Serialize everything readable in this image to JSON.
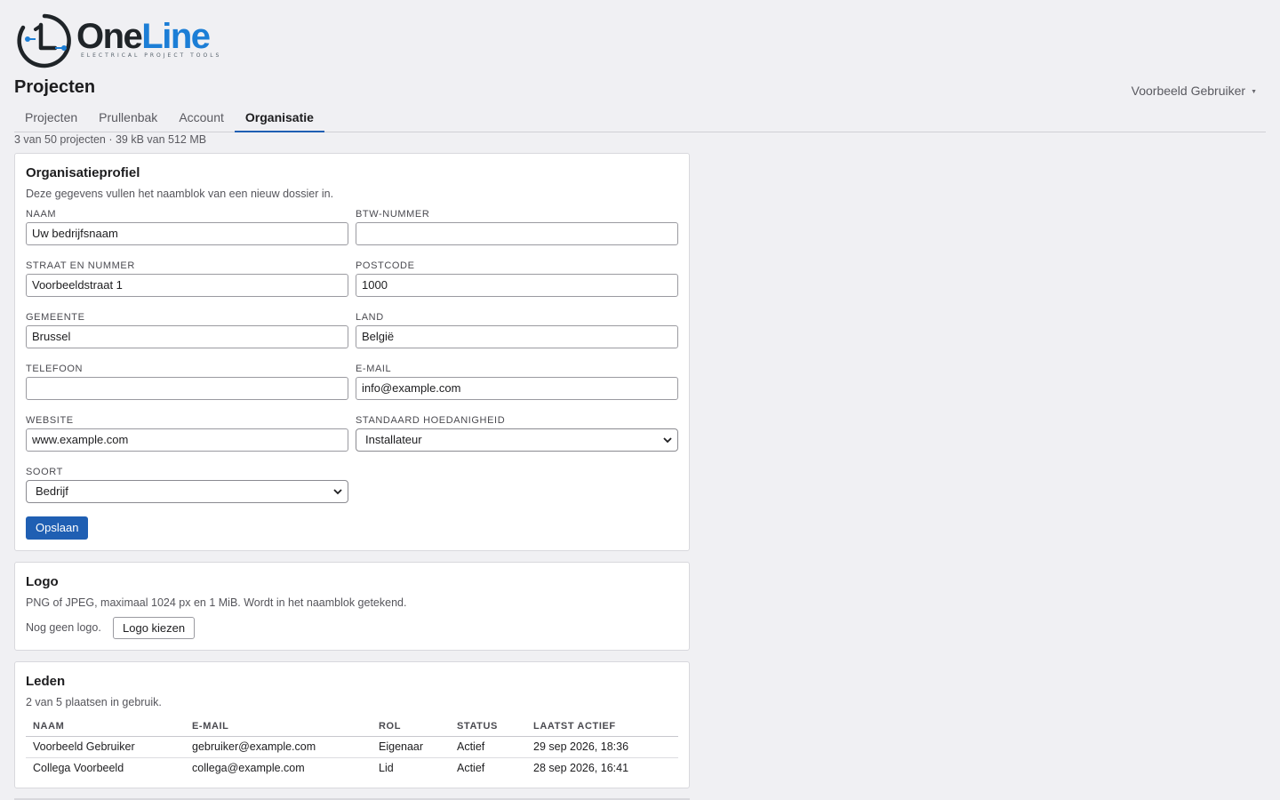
{
  "brand": {
    "name_part1": "One",
    "name_part2": "Line",
    "tagline": "ELECTRICAL PROJECT TOOLS",
    "color_dark": "#1f2428",
    "color_accent": "#1c7ed6"
  },
  "header": {
    "title": "Projecten",
    "user_name": "Voorbeeld Gebruiker",
    "user_menu_icon": "caret-down-icon"
  },
  "tabs": [
    {
      "label": "Projecten",
      "active": false
    },
    {
      "label": "Prullenbak",
      "active": false
    },
    {
      "label": "Account",
      "active": false
    },
    {
      "label": "Organisatie",
      "active": true
    }
  ],
  "usage": "3 van 50 projecten · 39 kB van 512 MB",
  "org_profile": {
    "title": "Organisatieprofiel",
    "description": "Deze gegevens vullen het naamblok van een nieuw dossier in.",
    "fields": {
      "naam": {
        "label": "NAAM",
        "value": "Uw bedrijfsnaam"
      },
      "btw": {
        "label": "BTW-NUMMER",
        "value": ""
      },
      "straat": {
        "label": "STRAAT EN NUMMER",
        "value": "Voorbeeldstraat 1"
      },
      "postcode": {
        "label": "POSTCODE",
        "value": "1000"
      },
      "gemeente": {
        "label": "GEMEENTE",
        "value": "Brussel"
      },
      "land": {
        "label": "LAND",
        "value": "België"
      },
      "telefoon": {
        "label": "TELEFOON",
        "value": ""
      },
      "email": {
        "label": "E-MAIL",
        "value": "info@example.com"
      },
      "website": {
        "label": "WEBSITE",
        "value": "www.example.com"
      },
      "hoedanigheid": {
        "label": "STANDAARD HOEDANIGHEID",
        "value": "Installateur"
      },
      "soort": {
        "label": "SOORT",
        "value": "Bedrijf"
      }
    },
    "save_label": "Opslaan",
    "accent_color": "#1f5fb3"
  },
  "logo_section": {
    "title": "Logo",
    "description": "PNG of JPEG, maximaal 1024 px en 1 MiB. Wordt in het naamblok getekend.",
    "status": "Nog geen logo.",
    "button_label": "Logo kiezen"
  },
  "members": {
    "title": "Leden",
    "description": "2 van 5 plaatsen in gebruik.",
    "columns": [
      "NAAM",
      "E-MAIL",
      "ROL",
      "STATUS",
      "LAATST ACTIEF"
    ],
    "rows": [
      [
        "Voorbeeld Gebruiker",
        "gebruiker@example.com",
        "Eigenaar",
        "Actief",
        "29 sep 2026, 18:36"
      ],
      [
        "Collega Voorbeeld",
        "collega@example.com",
        "Lid",
        "Actief",
        "28 sep 2026, 16:41"
      ]
    ]
  }
}
